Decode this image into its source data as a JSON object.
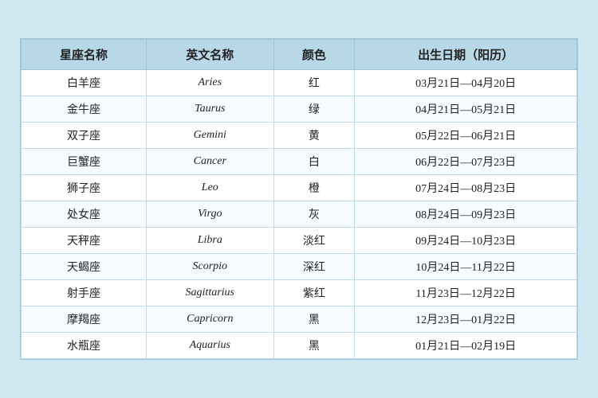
{
  "table": {
    "headers": [
      "星座名称",
      "英文名称",
      "颜色",
      "出生日期（阳历）"
    ],
    "rows": [
      {
        "chinese": "白羊座",
        "english": "Aries",
        "color": "红",
        "dates": "03月21日—04月20日"
      },
      {
        "chinese": "金牛座",
        "english": "Taurus",
        "color": "绿",
        "dates": "04月21日—05月21日"
      },
      {
        "chinese": "双子座",
        "english": "Gemini",
        "color": "黄",
        "dates": "05月22日—06月21日"
      },
      {
        "chinese": "巨蟹座",
        "english": "Cancer",
        "color": "白",
        "dates": "06月22日—07月23日"
      },
      {
        "chinese": "狮子座",
        "english": "Leo",
        "color": "橙",
        "dates": "07月24日—08月23日"
      },
      {
        "chinese": "处女座",
        "english": "Virgo",
        "color": "灰",
        "dates": "08月24日—09月23日"
      },
      {
        "chinese": "天秤座",
        "english": "Libra",
        "color": "淡红",
        "dates": "09月24日—10月23日"
      },
      {
        "chinese": "天蝎座",
        "english": "Scorpio",
        "color": "深红",
        "dates": "10月24日—11月22日"
      },
      {
        "chinese": "射手座",
        "english": "Sagittarius",
        "color": "紫红",
        "dates": "11月23日—12月22日"
      },
      {
        "chinese": "摩羯座",
        "english": "Capricorn",
        "color": "黑",
        "dates": "12月23日—01月22日"
      },
      {
        "chinese": "水瓶座",
        "english": "Aquarius",
        "color": "黑",
        "dates": "01月21日—02月19日"
      }
    ]
  }
}
